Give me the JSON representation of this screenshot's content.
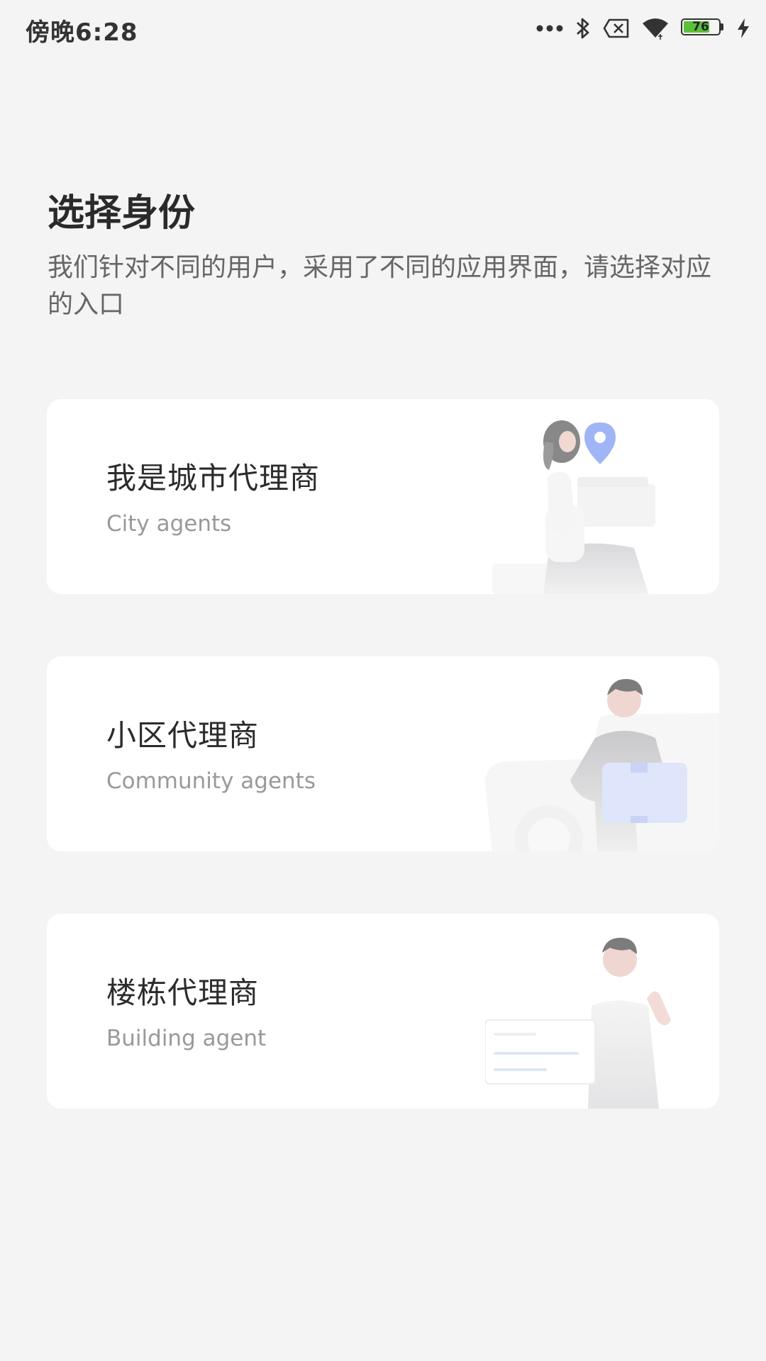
{
  "status_bar": {
    "time": "傍晚6:28",
    "battery_level": "76",
    "icons": [
      "more-dots-icon",
      "bluetooth-icon",
      "sim-off-icon",
      "wifi-icon",
      "battery-icon",
      "charging-icon"
    ]
  },
  "header": {
    "title": "选择身份",
    "subtitle": "我们针对不同的用户，采用了不同的应用界面，请选择对应的入口"
  },
  "cards": [
    {
      "title": "我是城市代理商",
      "subtitle": "City agents"
    },
    {
      "title": "小区代理商",
      "subtitle": "Community agents"
    },
    {
      "title": "楼栋代理商",
      "subtitle": "Building agent"
    }
  ],
  "colors": {
    "background": "#f4f4f4",
    "card": "#ffffff",
    "accent_blue": "#8ea8f5",
    "battery_green": "#5bbf3a"
  }
}
